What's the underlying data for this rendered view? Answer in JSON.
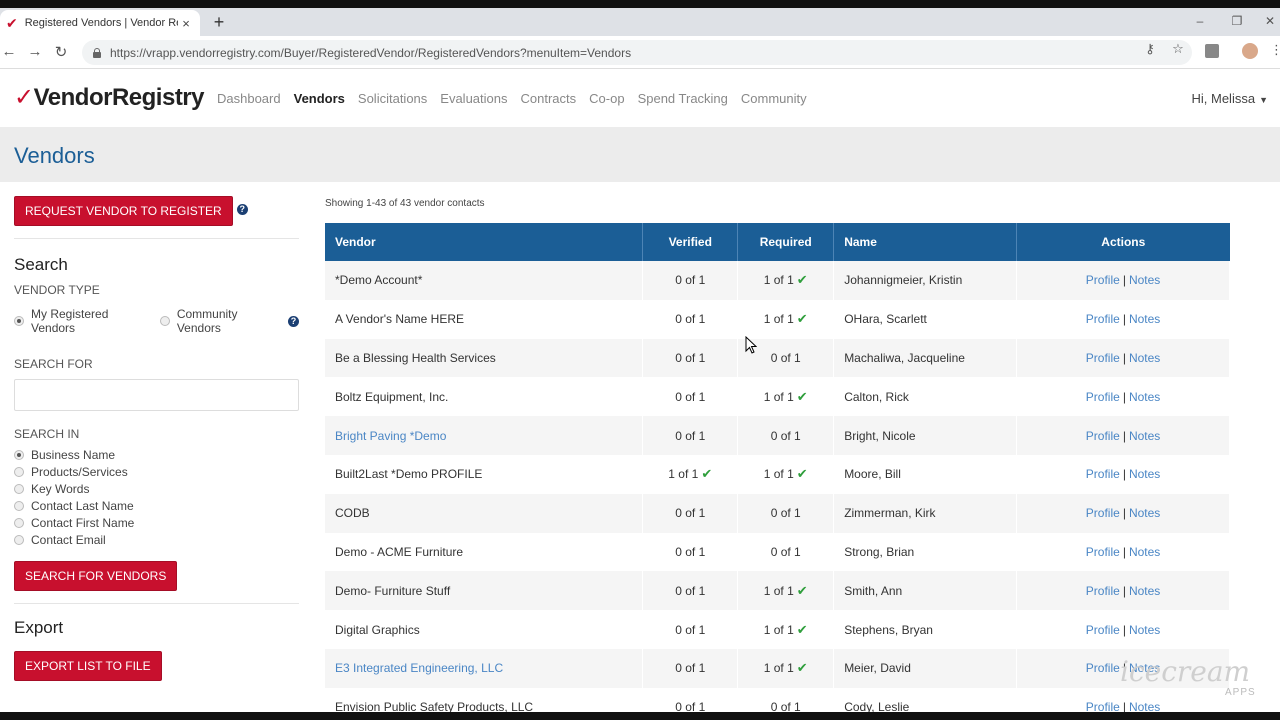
{
  "browser": {
    "tab_title": "Registered Vendors | Vendor Regis",
    "tab_close": "×",
    "new_tab": "+",
    "url": "https://vrapp.vendorregistry.com/Buyer/RegisteredVendor/RegisteredVendors?menuItem=Vendors"
  },
  "header": {
    "logo_text": "VendorRegistry",
    "nav": [
      "Dashboard",
      "Vendors",
      "Solicitations",
      "Evaluations",
      "Contracts",
      "Co-op",
      "Spend Tracking",
      "Community"
    ],
    "active_nav": "Vendors",
    "user_greeting": "Hi, Melissa"
  },
  "page_title": "Vendors",
  "sidebar": {
    "request_button": "REQUEST VENDOR TO REGISTER",
    "search_heading": "Search",
    "vendor_type_label": "VENDOR TYPE",
    "vendor_type_options": [
      "My Registered Vendors",
      "Community Vendors"
    ],
    "search_for_label": "SEARCH FOR",
    "search_for_value": "",
    "search_in_label": "SEARCH IN",
    "search_in_options": [
      "Business Name",
      "Products/Services",
      "Key Words",
      "Contact Last Name",
      "Contact First Name",
      "Contact Email"
    ],
    "search_button": "SEARCH FOR VENDORS",
    "export_heading": "Export",
    "export_button": "EXPORT LIST TO FILE"
  },
  "table": {
    "showing": "Showing 1-43 of 43 vendor contacts",
    "headers": [
      "Vendor",
      "Verified",
      "Required",
      "Name",
      "Actions"
    ],
    "profile_label": "Profile",
    "notes_label": "Notes",
    "rows": [
      {
        "vendor": "*Demo Account*",
        "linked": false,
        "verified": "0 of 1",
        "verified_ok": false,
        "required": "1 of 1",
        "required_ok": true,
        "name": "Johannigmeier, Kristin"
      },
      {
        "vendor": "A Vendor's Name HERE",
        "linked": false,
        "verified": "0 of 1",
        "verified_ok": false,
        "required": "1 of 1",
        "required_ok": true,
        "name": "OHara, Scarlett"
      },
      {
        "vendor": "Be a Blessing Health Services",
        "linked": false,
        "verified": "0 of 1",
        "verified_ok": false,
        "required": "0 of 1",
        "required_ok": false,
        "name": "Machaliwa, Jacqueline"
      },
      {
        "vendor": "Boltz Equipment, Inc.",
        "linked": false,
        "verified": "0 of 1",
        "verified_ok": false,
        "required": "1 of 1",
        "required_ok": true,
        "name": "Calton, Rick"
      },
      {
        "vendor": "Bright Paving *Demo",
        "linked": true,
        "verified": "0 of 1",
        "verified_ok": false,
        "required": "0 of 1",
        "required_ok": false,
        "name": "Bright, Nicole"
      },
      {
        "vendor": "Built2Last *Demo PROFILE",
        "linked": false,
        "verified": "1 of 1",
        "verified_ok": true,
        "required": "1 of 1",
        "required_ok": true,
        "name": "Moore, Bill"
      },
      {
        "vendor": "CODB",
        "linked": false,
        "verified": "0 of 1",
        "verified_ok": false,
        "required": "0 of 1",
        "required_ok": false,
        "name": "Zimmerman, Kirk"
      },
      {
        "vendor": "Demo - ACME Furniture",
        "linked": false,
        "verified": "0 of 1",
        "verified_ok": false,
        "required": "0 of 1",
        "required_ok": false,
        "name": "Strong, Brian"
      },
      {
        "vendor": "Demo- Furniture Stuff",
        "linked": false,
        "verified": "0 of 1",
        "verified_ok": false,
        "required": "1 of 1",
        "required_ok": true,
        "name": "Smith, Ann"
      },
      {
        "vendor": "Digital Graphics",
        "linked": false,
        "verified": "0 of 1",
        "verified_ok": false,
        "required": "1 of 1",
        "required_ok": true,
        "name": "Stephens, Bryan"
      },
      {
        "vendor": "E3 Integrated Engineering, LLC",
        "linked": true,
        "verified": "0 of 1",
        "verified_ok": false,
        "required": "1 of 1",
        "required_ok": true,
        "name": "Meier, David"
      },
      {
        "vendor": "Envision Public Safety Products, LLC",
        "linked": false,
        "verified": "0 of 1",
        "verified_ok": false,
        "required": "0 of 1",
        "required_ok": false,
        "name": "Cody, Leslie"
      }
    ]
  },
  "watermark": {
    "text": "icecream",
    "sub": "APPS"
  },
  "colors": {
    "brand_red": "#c8102e",
    "header_blue": "#1b5e96",
    "link_blue": "#4a86c5",
    "check_green": "#2e9e3b"
  }
}
